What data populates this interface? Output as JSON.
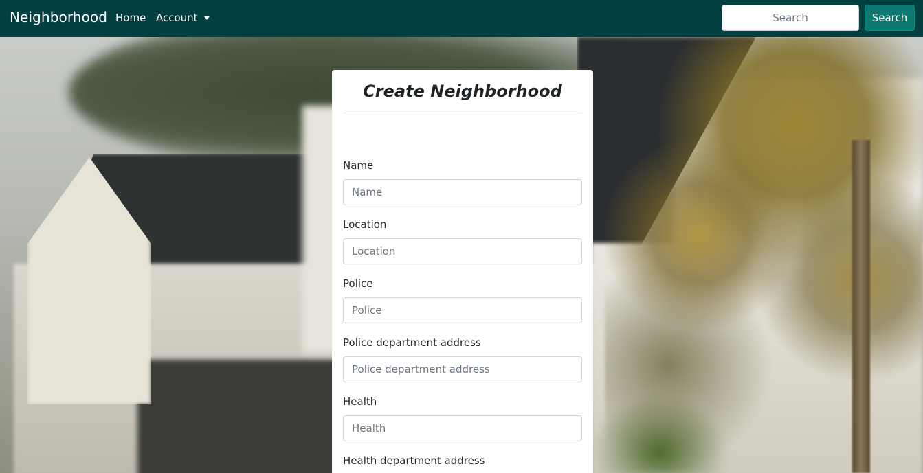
{
  "navbar": {
    "brand": "Neighborhood",
    "links": [
      {
        "label": "Home"
      },
      {
        "label": "Account",
        "dropdown": true
      }
    ],
    "search": {
      "placeholder": "Search",
      "value": "",
      "button_label": "Search"
    },
    "colors": {
      "background": "#023f40",
      "search_button": "#0d7a72"
    }
  },
  "form": {
    "title": "Create Neighborhood",
    "fields": [
      {
        "label": "Name",
        "placeholder": "Name",
        "value": ""
      },
      {
        "label": "Location",
        "placeholder": "Location",
        "value": ""
      },
      {
        "label": "Police",
        "placeholder": "Police",
        "value": ""
      },
      {
        "label": "Police department address",
        "placeholder": "Police department address",
        "value": ""
      },
      {
        "label": "Health",
        "placeholder": "Health",
        "value": ""
      },
      {
        "label": "Health department address",
        "placeholder": "",
        "value": ""
      }
    ]
  }
}
